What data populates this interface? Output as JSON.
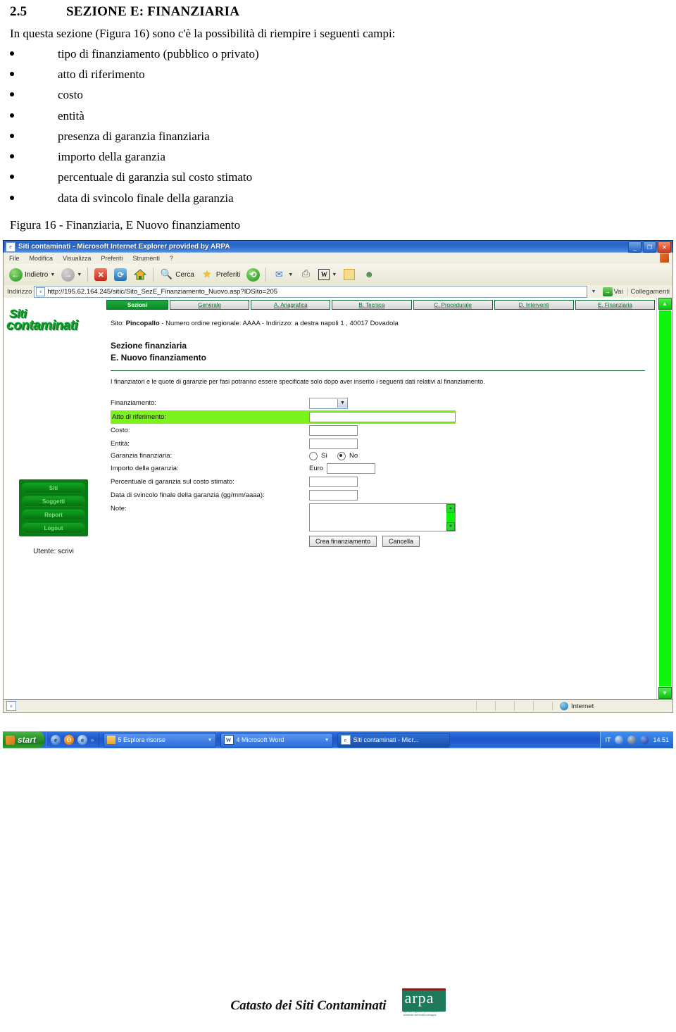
{
  "document": {
    "section_number": "2.5",
    "section_title": "SEZIONE E: FINANZIARIA",
    "intro": "In questa sezione (Figura 16) sono c'è la possibilità di riempire i seguenti campi:",
    "bullets": [
      "tipo di finanziamento (pubblico o privato)",
      "atto di riferimento",
      "costo",
      "entità",
      "presenza di garanzia finanziaria",
      "importo della garanzia",
      "percentuale di garanzia sul costo stimato",
      "data di svincolo finale della garanzia"
    ],
    "figure_caption": "Figura 16 - Finanziaria, E Nuovo finanziamento"
  },
  "browser": {
    "title": "Siti contaminati - Microsoft Internet Explorer provided by ARPA",
    "window_buttons": {
      "minimize": "_",
      "restore": "❐",
      "close": "✕"
    },
    "menu": [
      "File",
      "Modifica",
      "Visualizza",
      "Preferiti",
      "Strumenti",
      "?"
    ],
    "toolbar": {
      "back": "Indietro",
      "forward": "",
      "stop": "✕",
      "refresh": "⟳",
      "home": "⌂",
      "search": "Cerca",
      "favorites": "Preferiti",
      "history": "⟲",
      "mail": "✉",
      "print": "⎙",
      "word": "W",
      "notes": "▮",
      "messenger": "☻"
    },
    "address": {
      "label": "Indirizzo",
      "url": "http://195.62.164.245/sitic/Sito_SezE_Finanziamento_Nuovo.asp?IDSito=205",
      "go_label": "Vai",
      "links_label": "Collegamenti"
    },
    "statusbar": {
      "zone": "Internet"
    }
  },
  "app": {
    "logo_line1": "Siti",
    "logo_line2": "contaminati",
    "tabs": [
      {
        "label": "Sezioni",
        "active": true
      },
      {
        "label": "Generale",
        "active": false
      },
      {
        "label": "A. Anagrafica",
        "active": false
      },
      {
        "label": "B. Tecnica",
        "active": false
      },
      {
        "label": "C. Procedurale",
        "active": false
      },
      {
        "label": "D. Interventi",
        "active": false
      },
      {
        "label": "E. Finanziaria",
        "active": false
      }
    ],
    "site_info_prefix": "Sito: ",
    "site_name": "Pincopallo",
    "site_info_suffix": " - Numero ordine regionale: AAAA - Indirizzo: a destra napoli 1 , 40017 Dovadola",
    "section_heading_1": "Sezione finanziaria",
    "section_heading_2": "E. Nuovo finanziamento",
    "hint": "I finanziatori e le quote di garanzie per fasi potranno essere specificate solo dopo aver inserito i seguenti dati relativi al finanziamento.",
    "form": {
      "finanziamento_label": "Finanziamento:",
      "finanziamento_value": "",
      "atto_label": "Atto di riferimento:",
      "atto_value": "",
      "costo_label": "Costo:",
      "costo_value": "",
      "entita_label": "Entità:",
      "entita_value": "",
      "garanzia_label": "Garanzia finanziaria:",
      "garanzia_yes": "Sì",
      "garanzia_no": "No",
      "garanzia_selected": "No",
      "importo_label": "Importo della garanzia:",
      "importo_currency": "Euro",
      "importo_value": "",
      "percentuale_label": "Percentuale di garanzia sul costo stimato:",
      "percentuale_value": "",
      "data_label": "Data di svincolo finale della garanzia (gg/mm/aaaa):",
      "data_value": "",
      "note_label": "Note:",
      "note_value": "",
      "submit_label": "Crea finanziamento",
      "cancel_label": "Cancella"
    },
    "sidebar": {
      "buttons": [
        "Siti",
        "Soggetti",
        "Report",
        "Logout"
      ],
      "user_line": "Utente: scrivi"
    }
  },
  "taskbar": {
    "start_label": "start",
    "quicklaunch_more": "»",
    "items": [
      {
        "label": "5 Esplora risorse",
        "icon": "folder-icon"
      },
      {
        "label": "4 Microsoft Word",
        "icon": "word-icon"
      },
      {
        "label": "Siti contaminati - Micr...",
        "icon": "ie-icon"
      }
    ],
    "locale": "IT",
    "clock": "14.51"
  },
  "footer": {
    "text": "Catasto dei Siti Contaminati",
    "logo_word": "arpa",
    "logo_sub": "agenzia regionale prevenzione e ambiente dell'emilia-romagna"
  },
  "colors": {
    "app_green": "#0a8a28",
    "highlight_green": "#7cf41b",
    "scrollbar_green": "#0df50d",
    "titlebar_blue": "#2a63c4",
    "arpa_green": "#1d7a5a"
  }
}
